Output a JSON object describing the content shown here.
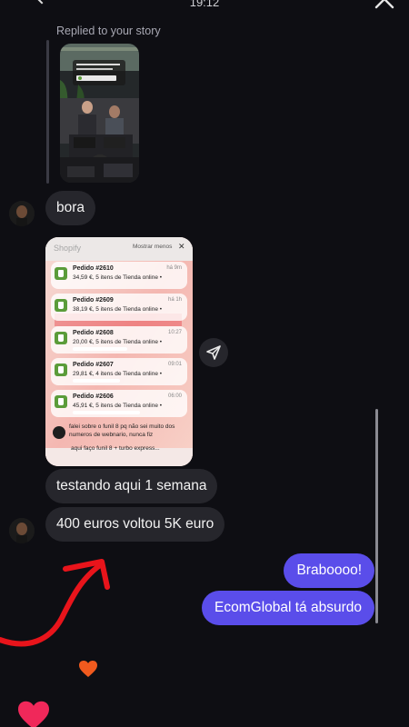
{
  "status": {
    "time": "19:12"
  },
  "story_reply": {
    "label": "Replied to your story"
  },
  "messages": {
    "incoming_1": "bora",
    "incoming_2": "testando aqui 1 semana",
    "incoming_3": "400 euros voltou 5K euro",
    "outgoing_1": "Braboooo!",
    "outgoing_2": "EcomGlobal tá absurdo"
  },
  "screenshot": {
    "app_name": "Shopify",
    "show_less": "Mostrar menos",
    "close": "✕",
    "orders": [
      {
        "title": "Pedido #2610",
        "body": "34,59 €, 5 itens de Tienda online •",
        "time": "há 9m"
      },
      {
        "title": "Pedido #2609",
        "body": "38,19 €, 5 itens de Tienda online •",
        "time": "há 1h"
      },
      {
        "title": "Pedido #2608",
        "body": "20,00 €, 5 itens de Tienda online •",
        "time": "10:27"
      },
      {
        "title": "Pedido #2607",
        "body": "29,81 €, 4 itens de Tienda online •",
        "time": "09:01"
      },
      {
        "title": "Pedido #2606",
        "body": "45,91 €, 5 itens de Tienda online •",
        "time": "06:00"
      }
    ],
    "chat_text": "falei sobre o funil 8 pq não sei muito dos numeros de webnario, nunca fiz",
    "chat_text_2": "aqui faço funil 8 + turbo express..."
  },
  "icons": {
    "share": "paper-plane-icon",
    "close": "close-icon",
    "back": "chevron-left-icon"
  },
  "colors": {
    "background": "#0e0e13",
    "incoming_bubble": "#26262c",
    "outgoing_bubble": "#5a4dea",
    "arrow": "#e8141b",
    "heart_orange": "#f05a1e",
    "heart_pink": "#f0285a"
  }
}
